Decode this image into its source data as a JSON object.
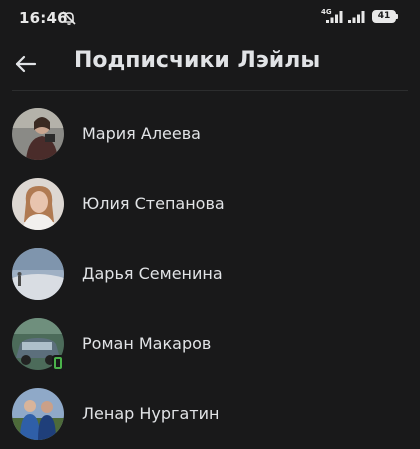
{
  "status_bar": {
    "time": "16:46",
    "mute_icon": "bell-off-icon",
    "network_type": "4G",
    "battery_level": "41"
  },
  "header": {
    "back_icon": "arrow-left-icon",
    "title": "Подписчики Лэйлы"
  },
  "followers": [
    {
      "name": "Мария Алеева",
      "online_mobile": false
    },
    {
      "name": "Юлия Степанова",
      "online_mobile": false
    },
    {
      "name": "Дарья Семенина",
      "online_mobile": false
    },
    {
      "name": "Роман Макаров",
      "online_mobile": true
    },
    {
      "name": "Ленар Нургатин",
      "online_mobile": false
    }
  ],
  "colors": {
    "background": "#19191a",
    "text_primary": "#e1e3e6",
    "online_green": "#4bb34b"
  }
}
